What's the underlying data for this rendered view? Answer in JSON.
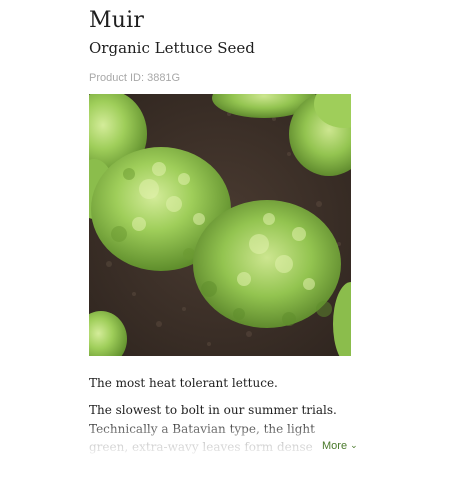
{
  "product": {
    "name": "Muir",
    "subtitle": "Organic Lettuce Seed",
    "product_id": "Product ID: 3881G",
    "tagline": "The most heat tolerant lettuce.",
    "description": "The slowest to bolt in our summer trials. Technically a Batavian type, the light green, extra-wavy leaves form dense heads at a small size and hold well in heat.",
    "more_label": "More",
    "more_icon": "chevron-down-icon",
    "image_subject": "lettuce-heads-in-soil"
  },
  "colors": {
    "link": "#4a7a2b",
    "muted_text": "#a8a8a8",
    "soil": "#3b2f27",
    "leaf": "#8cc152"
  }
}
